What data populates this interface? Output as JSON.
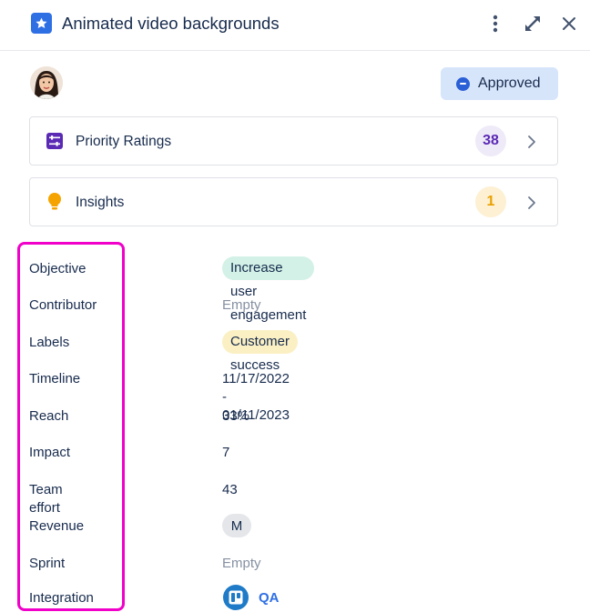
{
  "header": {
    "title": "Animated video backgrounds",
    "icons": {
      "badge": "star-icon",
      "more": "more-vertical-icon",
      "expand": "expand-icon",
      "close": "close-icon"
    }
  },
  "status": {
    "label": "Approved",
    "icon": "minus-circle-icon",
    "color": "#2b5fd6"
  },
  "cards": [
    {
      "label": "Priority Ratings",
      "count": "38",
      "icon": "sliders-icon",
      "accent": "#5b2ab5"
    },
    {
      "label": "Insights",
      "count": "1",
      "icon": "lightbulb-icon",
      "accent": "#f5a300"
    }
  ],
  "fields": {
    "objective": {
      "label": "Objective",
      "value": "Increase user engagement"
    },
    "contributor": {
      "label": "Contributor",
      "value": "Empty"
    },
    "labels": {
      "label": "Labels",
      "value": "Customer success"
    },
    "timeline": {
      "label": "Timeline",
      "value": "11/17/2022 - 01/11/2023"
    },
    "reach": {
      "label": "Reach",
      "value": "33%"
    },
    "impact": {
      "label": "Impact",
      "value": "7"
    },
    "team_effort": {
      "label": "Team effort",
      "value": "43"
    },
    "revenue": {
      "label": "Revenue",
      "value": "M"
    },
    "sprint": {
      "label": "Sprint",
      "value": "Empty"
    },
    "integration": {
      "label": "Integration",
      "value": "QA",
      "icon": "trello-icon"
    }
  }
}
